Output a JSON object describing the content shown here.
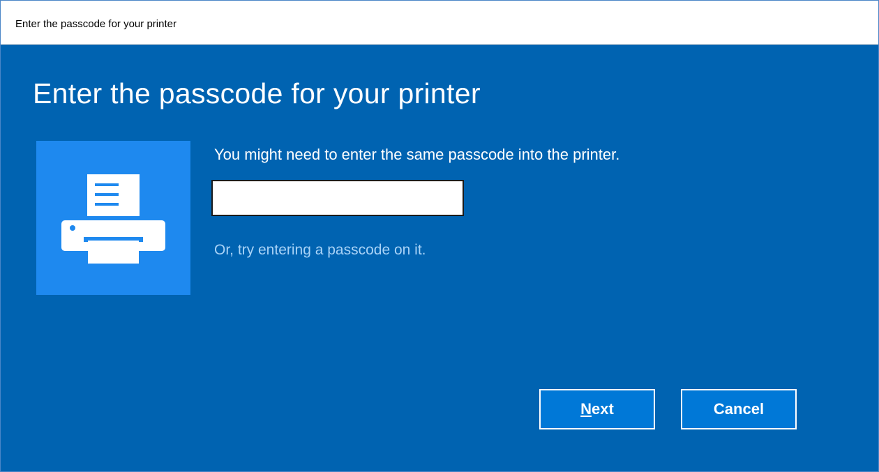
{
  "window": {
    "title": "Enter the passcode for your printer"
  },
  "dialog": {
    "heading": "Enter the passcode for your printer",
    "icon": "printer-icon",
    "instruction": "You might need to enter the same passcode into the printer.",
    "passcode": {
      "value": "",
      "placeholder": ""
    },
    "alt_link": "Or, try entering a passcode on it."
  },
  "buttons": {
    "next": {
      "mnemonic": "N",
      "rest": "ext"
    },
    "cancel": "Cancel"
  },
  "colors": {
    "background": "#0063b1",
    "icon_tile": "#1e89ef",
    "button": "#0078d7",
    "link": "#a8d3f7"
  }
}
